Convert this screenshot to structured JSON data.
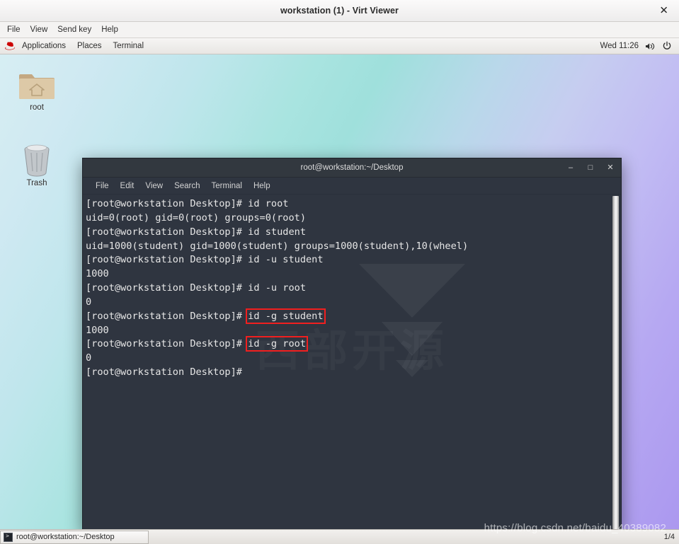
{
  "viewer": {
    "title": "workstation (1) - Virt Viewer",
    "close_label": "✕",
    "menu": [
      "File",
      "View",
      "Send key",
      "Help"
    ]
  },
  "gnome_panel": {
    "logo_icon": "redhat-icon",
    "items": [
      "Applications",
      "Places",
      "Terminal"
    ],
    "clock": "Wed 11:26",
    "volume_icon": "volume-icon",
    "power_icon": "power-icon"
  },
  "desktop": {
    "icons": [
      {
        "name": "root",
        "label": "root",
        "type": "home-folder-icon"
      },
      {
        "name": "trash",
        "label": "Trash",
        "type": "trash-icon"
      }
    ]
  },
  "terminal": {
    "title": "root@workstation:~/Desktop",
    "minimize_label": "–",
    "maximize_label": "□",
    "close_label": "✕",
    "menu": [
      "File",
      "Edit",
      "View",
      "Search",
      "Terminal",
      "Help"
    ],
    "watermark": "西部开源",
    "prompt": "[root@workstation Desktop]#",
    "highlight_color": "#f11f1f",
    "lines": [
      {
        "prompt": "[root@workstation Desktop]# ",
        "command": "id root",
        "highlight": false
      },
      {
        "output": "uid=0(root) gid=0(root) groups=0(root)"
      },
      {
        "prompt": "[root@workstation Desktop]# ",
        "command": "id student",
        "highlight": false
      },
      {
        "output": "uid=1000(student) gid=1000(student) groups=1000(student),10(wheel)"
      },
      {
        "prompt": "[root@workstation Desktop]# ",
        "command": "id -u student",
        "highlight": false
      },
      {
        "output": "1000"
      },
      {
        "prompt": "[root@workstation Desktop]# ",
        "command": "id -u root",
        "highlight": false
      },
      {
        "output": "0"
      },
      {
        "prompt": "[root@workstation Desktop]# ",
        "command": "id -g student",
        "highlight": true
      },
      {
        "output": "1000"
      },
      {
        "prompt": "[root@workstation Desktop]# ",
        "command": "id -g root",
        "highlight": true
      },
      {
        "output": "0"
      },
      {
        "prompt": "[root@workstation Desktop]# ",
        "command": "",
        "highlight": false
      }
    ]
  },
  "taskbar": {
    "window_button": "root@workstation:~/Desktop",
    "workspace": "1/4"
  },
  "watermark_url": "https://blog.csdn.net/baidu_40389082",
  "colors": {
    "terminal_bg": "#2f3540",
    "highlight_red": "#f11f1f",
    "panel_bg": "#f1efed"
  }
}
